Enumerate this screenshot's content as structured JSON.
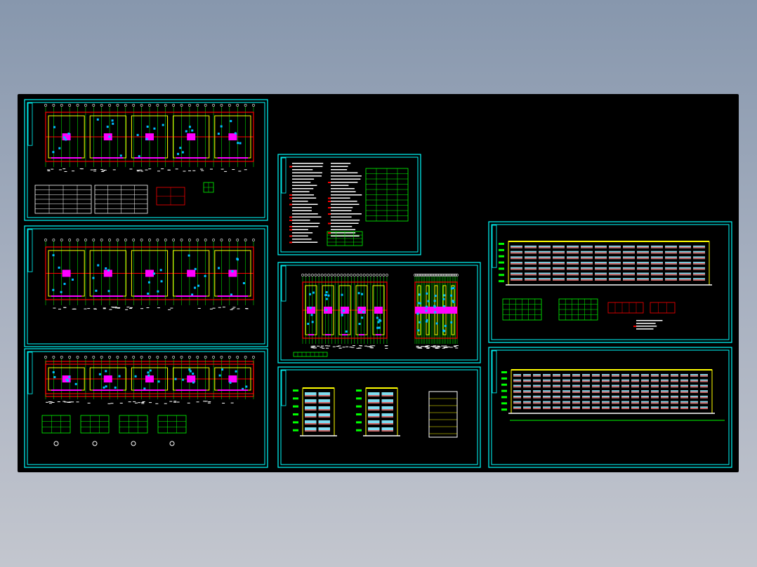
{
  "viewer": {
    "background": "cad-model-space",
    "canvas_color": "#000000"
  },
  "colors": {
    "frame": "#00ffff",
    "wall": "#ffff00",
    "axis": "#ff0000",
    "dim": "#00ff00",
    "text": "#ffffff",
    "accent": "#ff00ff"
  },
  "sheets": [
    {
      "kind": "floor-plan"
    },
    {
      "kind": "floor-plan"
    },
    {
      "kind": "roof-plan-with-details"
    },
    {
      "kind": "design-notes-and-schedule"
    },
    {
      "kind": "unit-plans"
    },
    {
      "kind": "section-elevations"
    },
    {
      "kind": "front-elevation-with-details"
    },
    {
      "kind": "rear-elevation"
    }
  ]
}
